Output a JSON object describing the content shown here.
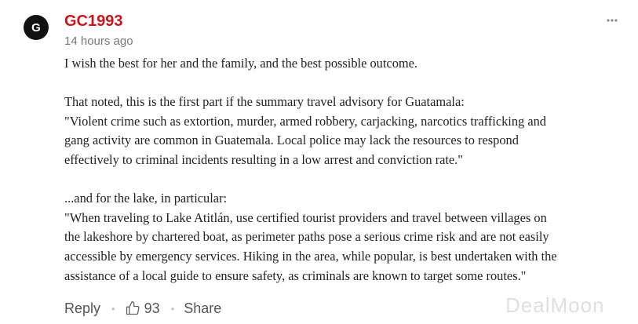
{
  "comment": {
    "avatar_initial": "G",
    "username": "GC1993",
    "timestamp": "14 hours ago",
    "paragraphs": [
      [
        "I wish the best for her and the family, and the best possible outcome."
      ],
      [
        "That noted, this is the first part if the summary travel advisory for Guatamala:",
        "\"Violent crime such as extortion, murder, armed robbery, carjacking, narcotics trafficking and",
        "gang activity are common in Guatemala. Local police may lack the resources to respond",
        "effectively to criminal incidents resulting in a low arrest and conviction rate.\""
      ],
      [
        "...and for the lake, in particular:",
        "\"When traveling to Lake Atitlán, use certified tourist providers and travel between villages on",
        "the lakeshore by chartered boat, as perimeter paths pose a serious crime risk and are not easily",
        "accessible by emergency services. Hiking in the area, while popular, is best undertaken with the",
        "assistance of a local guide to ensure safety, as criminals are known to target some routes.\""
      ]
    ]
  },
  "actions": {
    "reply_label": "Reply",
    "like_count": "93",
    "share_label": "Share",
    "separator": "•"
  },
  "watermark": "DealMoon",
  "colors": {
    "username": "#c8161d",
    "avatar_bg": "#111111",
    "body_text": "#222222",
    "muted": "#777777"
  },
  "icons": {
    "more": "more-horizontal-icon",
    "like": "thumbs-up-icon"
  }
}
